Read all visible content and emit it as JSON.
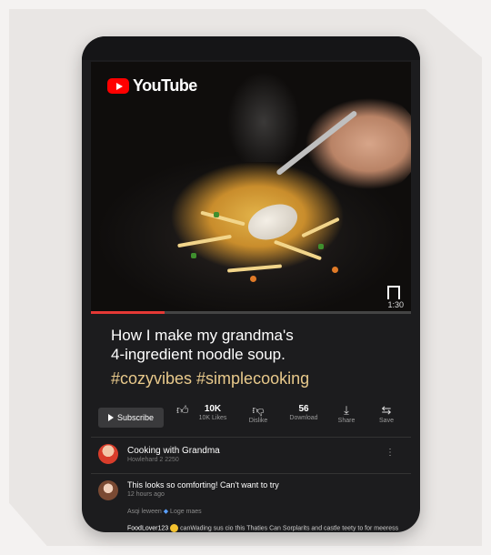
{
  "app": {
    "logo_text": "YouTube"
  },
  "video": {
    "duration": "1:30",
    "progress_fraction": 0.23
  },
  "post": {
    "title_line1": "How I make my grandma's",
    "title_line2": "4-ingredient noodle soup.",
    "hashtags": "#cozyvibes #simplecooking"
  },
  "actions": {
    "subscribe_label": "Subscribe",
    "like_count": "10K",
    "like_label": "10K Likes",
    "dislike_label": "Dislike",
    "download_count": "56",
    "download_label": "Download",
    "share_label": "Share",
    "save_label": "Save"
  },
  "channel": {
    "name": "Cooking with Grandma",
    "subtitle": "Howlehard 2 2250"
  },
  "comments": [
    {
      "text": "This looks so comforting! Can't want to try",
      "time": "12 hours ago",
      "reply_meta_a": "Asqi leween",
      "reply_meta_b": "Loge maes"
    }
  ],
  "reply": {
    "user": "FoodLover123",
    "text": "canWading sus cio this Thaties Can Sorplarits and castle teety to for meeress"
  },
  "icons": {
    "logo": "youtube-play-icon",
    "bookmark": "bookmark-icon",
    "like": "thumbs-up-icon",
    "dislike": "thumbs-down-icon",
    "download": "download-icon",
    "share": "share-icon",
    "save": "save-icon",
    "more": "more-vertical-icon"
  },
  "colors": {
    "accent": "#ff0000",
    "progress": "#e53935",
    "hashtag": "#e8c98b"
  }
}
